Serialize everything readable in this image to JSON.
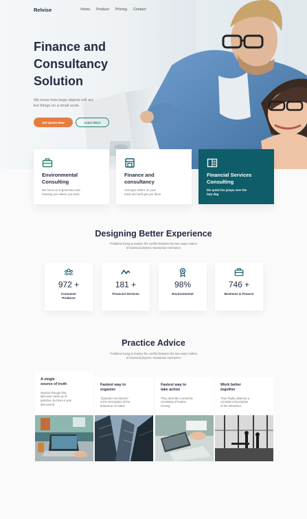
{
  "nav": {
    "brand": "Relvise",
    "links": [
      "Home",
      "Product",
      "Pricing",
      "Contact"
    ]
  },
  "hero": {
    "title_lines": [
      "Finance and",
      "Consultancy",
      "Solution"
    ],
    "subtitle_lines": [
      "We know how large objects will act,",
      "but things on a small scale."
    ],
    "primary_button": "Get Quote Now",
    "secondary_button": "Learn More"
  },
  "services": [
    {
      "icon": "briefcase-icon",
      "title_lines": [
        "Environmental",
        "Consulting"
      ],
      "text_lines": [
        "We focus on ergonomics and",
        "meeting you where you work."
      ]
    },
    {
      "icon": "storefront-icon",
      "title_lines": [
        "Finance and",
        "consultancy"
      ],
      "text_lines": [
        "Just type what's on your",
        "mind and we'll get you there."
      ]
    },
    {
      "icon": "book-icon",
      "title_lines": [
        "Financial Services",
        "Consulting"
      ],
      "text_lines": [
        "the quick fox jumps over the",
        "lazy dog"
      ]
    }
  ],
  "experience": {
    "title": "Designing Better Experience",
    "subtitle_lines": [
      "Problems trying to resolve the conflict between the two major realms",
      "of Classical physics: Newtonian mechanics"
    ],
    "stats": [
      {
        "icon": "users-icon",
        "value": "972 +",
        "label_lines": [
          "Consumer",
          "Products"
        ]
      },
      {
        "icon": "trend-icon",
        "value": "181 +",
        "label_lines": [
          "Financial Services"
        ]
      },
      {
        "icon": "award-icon",
        "value": "98%",
        "label_lines": [
          "Environmental"
        ]
      },
      {
        "icon": "briefcase-icon",
        "value": "746 +",
        "label_lines": [
          "Business & Finance"
        ]
      }
    ]
  },
  "practice": {
    "title": "Practice Advice",
    "subtitle_lines": [
      "Problems trying to resolve the conflict between the two major realms",
      "of Classical physics: Newtonian mechanics"
    ],
    "cards": [
      {
        "title_lines": [
          "A single",
          "source of truth"
        ],
        "text_lines": [
          "Newton thought that",
          "light was made up of",
          "particles, but then it was",
          "discovered"
        ]
      },
      {
        "title_lines": [
          "Fastest way to",
          "organize"
        ],
        "text_lines": [
          "\"Quantum mechanics\"",
          "is the description of the",
          "behaviour of matter"
        ]
      },
      {
        "title_lines": [
          "Fastest way to",
          "take action"
        ],
        "text_lines": [
          "They describe a universe",
          "consisting of bodies",
          "moving"
        ]
      },
      {
        "title_lines": [
          "Work better",
          "together"
        ],
        "text_lines": [
          "They finally obtained a",
          "consistent description",
          "of the behaviour"
        ]
      }
    ]
  },
  "colors": {
    "accent_orange": "#e77c40",
    "accent_green": "#23856d",
    "dark_teal": "#0e5d68",
    "text_dark": "#252b42",
    "text_muted": "#737373"
  }
}
